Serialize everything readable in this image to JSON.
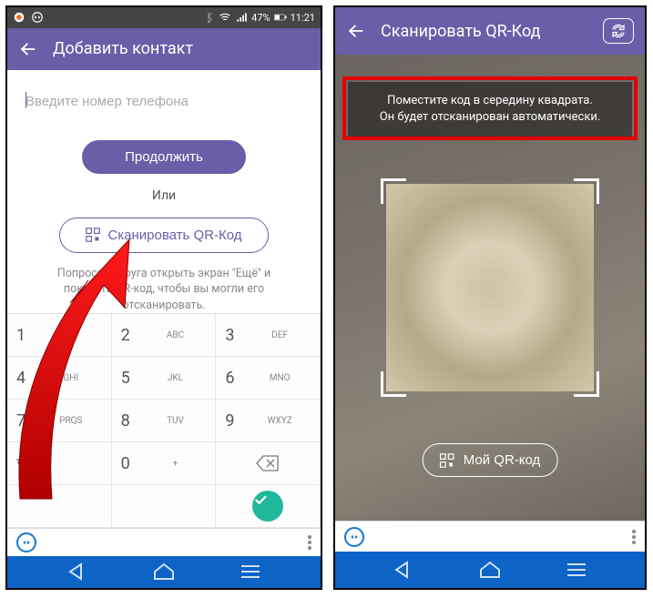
{
  "statusbar": {
    "battery_pct": "47%",
    "time": "11:21"
  },
  "left": {
    "title": "Добавить контакт",
    "phone_placeholder": "Введите номер телефона",
    "continue_label": "Продолжить",
    "or_label": "Или",
    "scan_label": "Сканировать QR-Код",
    "hint": "Попросите друга открыть экран \"Ещё\" и показать QR-код, чтобы вы могли его отсканировать."
  },
  "keypad": {
    "keys": [
      {
        "d": "1",
        "l": ""
      },
      {
        "d": "2",
        "l": "ABC"
      },
      {
        "d": "3",
        "l": "DEF"
      },
      {
        "d": "4",
        "l": "GHI"
      },
      {
        "d": "5",
        "l": "JKL"
      },
      {
        "d": "6",
        "l": "MNO"
      },
      {
        "d": "7",
        "l": "PRQS"
      },
      {
        "d": "8",
        "l": "TUV"
      },
      {
        "d": "9",
        "l": "WXYZ"
      },
      {
        "d": "* #",
        "l": ""
      },
      {
        "d": "0",
        "l": "+"
      }
    ]
  },
  "right": {
    "title": "Сканировать QR-Код",
    "instruction_line1": "Поместите код в середину квадрата.",
    "instruction_line2": "Он будет отсканирован автоматически.",
    "myqr_label": "Мой QR-код"
  }
}
